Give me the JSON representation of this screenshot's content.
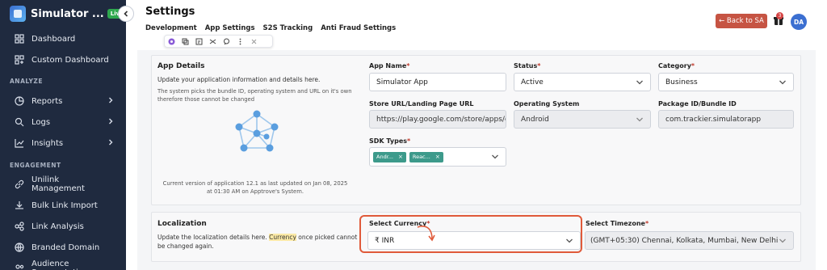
{
  "sidebar": {
    "app_name": "Simulator ...",
    "badge": "Live",
    "collapse_icon": "chevron-left-icon",
    "items": [
      {
        "label": "Dashboard",
        "icon": "grid-icon"
      },
      {
        "label": "Custom Dashboard",
        "icon": "layout-icon"
      },
      {
        "label": "Reports",
        "icon": "chart-icon",
        "expandable": true
      },
      {
        "label": "Logs",
        "icon": "search-icon",
        "expandable": true
      },
      {
        "label": "Insights",
        "icon": "trend-icon",
        "expandable": true
      },
      {
        "label": "Unilink Management",
        "icon": "link-icon"
      },
      {
        "label": "Bulk Link Import",
        "icon": "import-icon"
      },
      {
        "label": "Link Analysis",
        "icon": "analysis-icon"
      },
      {
        "label": "Branded Domain",
        "icon": "globe-icon"
      },
      {
        "label": "Audience Segmentation",
        "icon": "users-icon"
      }
    ],
    "sections": {
      "analyze": "ANALYZE",
      "engagement": "ENGAGEMENT"
    }
  },
  "header": {
    "title": "Settings",
    "tabs": [
      "Development",
      "App Settings",
      "S2S Tracking",
      "Anti Fraud Settings"
    ],
    "back_button": "← Back to SA",
    "notification_count": "3",
    "avatar_initials": "DA"
  },
  "app_details": {
    "title": "App Details",
    "description": "Update your application information and details here.",
    "note": "The system picks the bundle ID, operating system and URL on it's own therefore those cannot be changed",
    "version_text": "Current version of application 12.1 as last updated on Jan 08, 2025 at 01:30 AM on Apptrove's System.",
    "fields": {
      "app_name": {
        "label": "App Name",
        "value": "Simulator App"
      },
      "status": {
        "label": "Status",
        "value": "Active"
      },
      "category": {
        "label": "Category",
        "value": "Business"
      },
      "store_url": {
        "label": "Store URL/Landing Page URL",
        "value": "https://play.google.com/store/apps/d"
      },
      "os": {
        "label": "Operating System",
        "value": "Android"
      },
      "package_id": {
        "label": "Package ID/Bundle ID",
        "value": "com.trackier.simulatorapp"
      },
      "sdk_types": {
        "label": "SDK Types",
        "chips": [
          "Andr...",
          "Reac..."
        ],
        "remove_glyph": "×"
      }
    },
    "illustration_icon": "network-icon"
  },
  "localization": {
    "title": "Localization",
    "description_pre": "Update the localization details here. ",
    "description_highlight": "Currency",
    "description_post": " once picked cannot be changed again.",
    "currency": {
      "label": "Select Currency",
      "value": "₹ INR"
    },
    "timezone": {
      "label": "Select Timezone",
      "value": "(GMT+05:30) Chennai, Kolkata, Mumbai, New Delhi"
    }
  },
  "required_mark": "*",
  "colors": {
    "sidebar_bg": "#1f2a3f",
    "back_button": "#c65443",
    "chip": "#3d9a8b",
    "highlight_box": "#e05a3a",
    "avatar": "#3b6fd1",
    "live_badge": "#2fa84f"
  }
}
